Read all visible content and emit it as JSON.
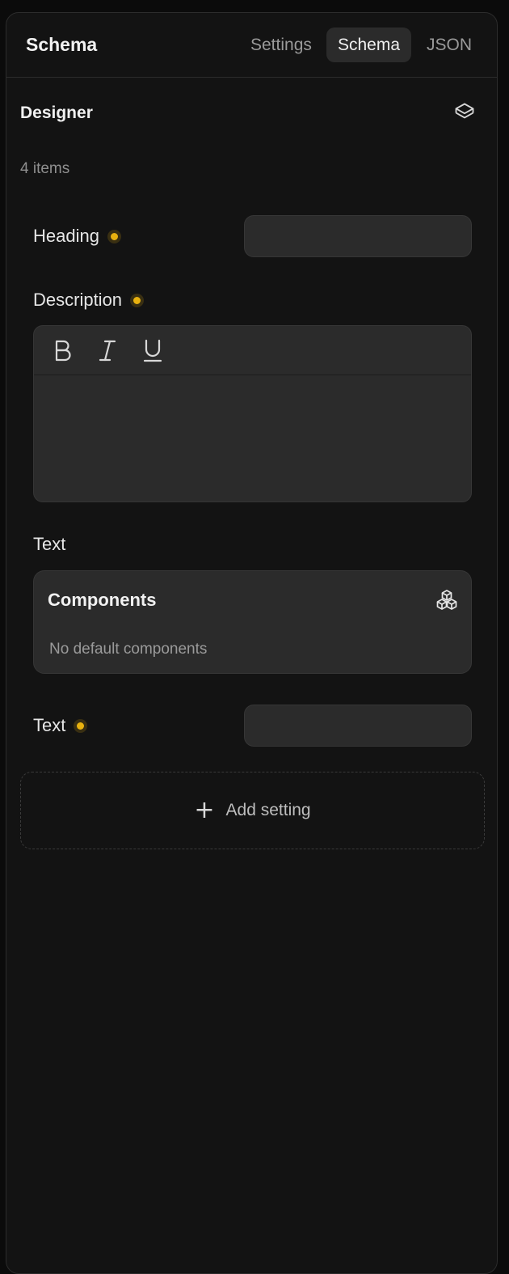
{
  "header": {
    "title": "Schema",
    "tabs": [
      {
        "label": "Settings",
        "active": false
      },
      {
        "label": "Schema",
        "active": true
      },
      {
        "label": "JSON",
        "active": false
      }
    ]
  },
  "designer": {
    "title": "Designer",
    "icon": "layers-icon",
    "count_text": "4 items",
    "fields": {
      "heading": {
        "label": "Heading",
        "value": "",
        "modified": true
      },
      "description": {
        "label": "Description",
        "modified": true,
        "toolbar": [
          "bold-icon",
          "italic-icon",
          "underline-icon"
        ]
      },
      "text_components": {
        "label": "Text",
        "components_title": "Components",
        "components_icon": "cubes-icon",
        "empty_text": "No default components"
      },
      "text": {
        "label": "Text",
        "value": "",
        "modified": true
      }
    },
    "add_setting": {
      "label": "Add setting",
      "icon": "plus-icon"
    }
  },
  "colors": {
    "accent_dot": "#e8b10f",
    "panel_bg": "#131313",
    "field_bg": "#2b2b2b"
  }
}
